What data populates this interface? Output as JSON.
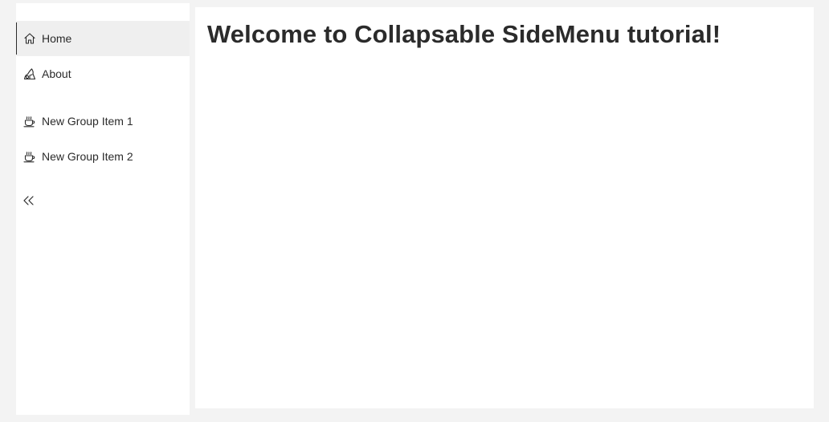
{
  "sidebar": {
    "primary_items": [
      {
        "label": "Home",
        "icon": "home-icon",
        "selected": true
      },
      {
        "label": "About",
        "icon": "about-icon",
        "selected": false
      }
    ],
    "group_items": [
      {
        "label": "New Group Item 1",
        "icon": "coffee-cup-icon"
      },
      {
        "label": "New Group Item 2",
        "icon": "coffee-cup-icon"
      }
    ],
    "collapse_icon": "double-chevron-left-icon"
  },
  "content": {
    "heading": "Welcome to Collapsable SideMenu tutorial!"
  },
  "colors": {
    "page_background": "#f3f3f3",
    "panel_background": "#ffffff",
    "selected_item_background": "#efefef",
    "text": "#2b2b2b"
  }
}
